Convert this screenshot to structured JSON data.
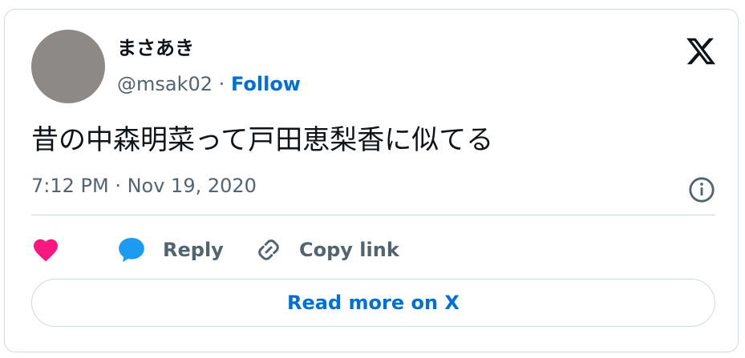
{
  "user": {
    "name": "まさあき",
    "handle": "@msak02",
    "separator": "·",
    "follow_label": "Follow"
  },
  "tweet": {
    "text": "昔の中森明菜って戸田恵梨香に似てる",
    "timestamp": "7:12 PM · Nov 19, 2020"
  },
  "actions": {
    "reply_label": "Reply",
    "copy_link_label": "Copy link"
  },
  "read_more_label": "Read more on X",
  "icons": [
    "x-logo-icon",
    "info-icon",
    "heart-icon",
    "reply-bubble-icon",
    "link-icon"
  ],
  "colors": {
    "accent_blue": "#006fd6",
    "heart": "#f91880",
    "reply_bubble": "#1d9bf0",
    "muted_text": "#536471",
    "border": "#cfd9de"
  }
}
